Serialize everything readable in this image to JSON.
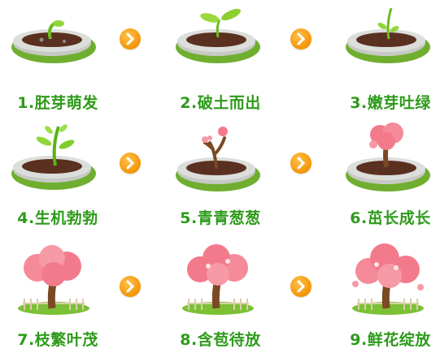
{
  "stages": [
    {
      "label": "1.胚芽萌发",
      "icon": "sprouting-seed-pot-icon"
    },
    {
      "label": "2.破土而出",
      "icon": "two-leaf-seedling-pot-icon"
    },
    {
      "label": "3.嫩芽吐绿",
      "icon": "tall-sprout-pot-icon"
    },
    {
      "label": "4.生机勃勃",
      "icon": "leafy-sprout-pot-icon"
    },
    {
      "label": "5.青青葱葱",
      "icon": "sapling-heart-buds-pot-icon"
    },
    {
      "label": "6.茁长成长",
      "icon": "young-heart-tree-pot-icon"
    },
    {
      "label": "7.枝繁叶茂",
      "icon": "heart-tree-fence-icon"
    },
    {
      "label": "8.含苞待放",
      "icon": "budding-heart-tree-fence-icon"
    },
    {
      "label": "9.鲜花绽放",
      "icon": "blooming-heart-tree-fence-icon"
    }
  ],
  "arrow_icon": "next-arrow-icon",
  "colors": {
    "label": "#2d9b1a",
    "arrow": "#f49406",
    "pink": "#f37a8b",
    "soil": "#5a3020"
  }
}
